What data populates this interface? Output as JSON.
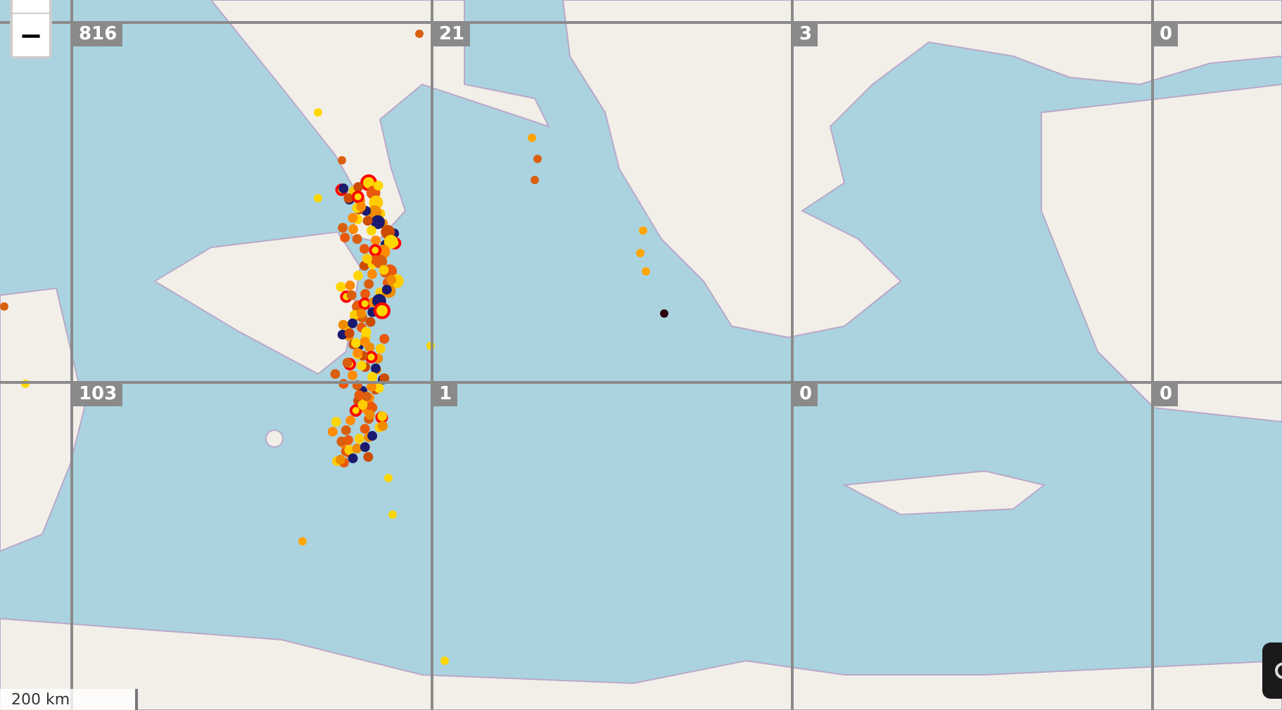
{
  "zoom_control": {
    "zoom_out": "−"
  },
  "grid_tiles": [
    {
      "label": "816"
    },
    {
      "label": "21"
    },
    {
      "label": "3"
    },
    {
      "label": "0"
    },
    {
      "label": "103"
    },
    {
      "label": "1"
    },
    {
      "label": "0"
    },
    {
      "label": "0"
    }
  ],
  "scale_bar": {
    "label": "200 km"
  }
}
